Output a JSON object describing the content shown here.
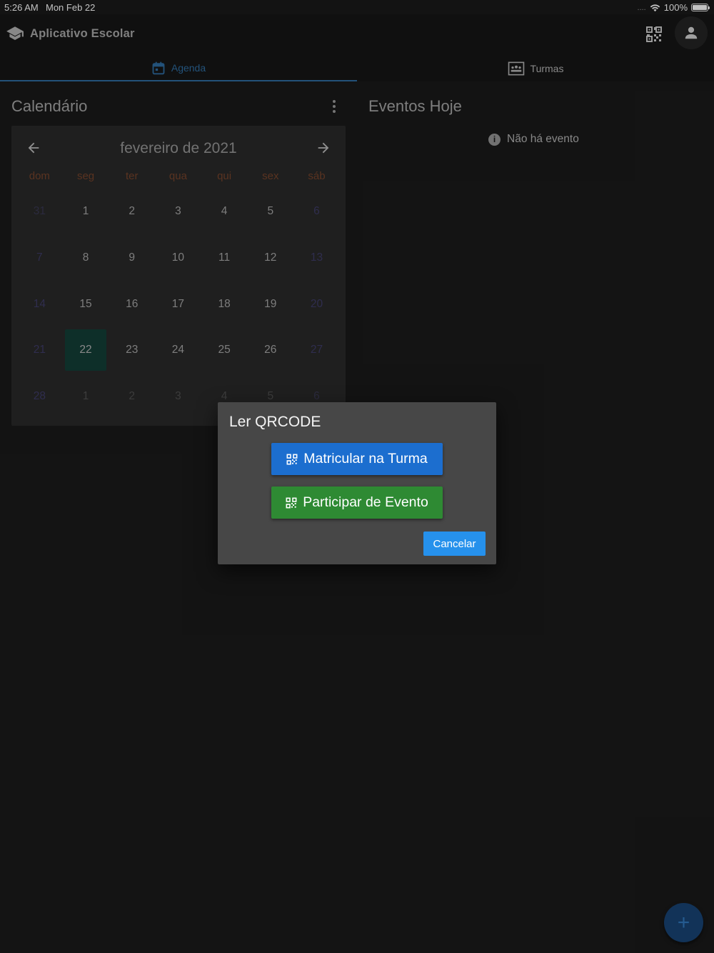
{
  "status_bar": {
    "time": "5:26 AM",
    "date": "Mon Feb 22",
    "signal": "....",
    "battery": "100%"
  },
  "header": {
    "title": "Aplicativo Escolar"
  },
  "tabs": [
    {
      "label": "Agenda",
      "active": true
    },
    {
      "label": "Turmas",
      "active": false
    }
  ],
  "calendar": {
    "title": "Calendário",
    "month_label": "fevereiro de 2021",
    "weekdays": [
      "dom",
      "seg",
      "ter",
      "qua",
      "qui",
      "sex",
      "sáb"
    ],
    "weeks": [
      [
        "31",
        "1",
        "2",
        "3",
        "4",
        "5",
        "6"
      ],
      [
        "7",
        "8",
        "9",
        "10",
        "11",
        "12",
        "13"
      ],
      [
        "14",
        "15",
        "16",
        "17",
        "18",
        "19",
        "20"
      ],
      [
        "21",
        "22",
        "23",
        "24",
        "25",
        "26",
        "27"
      ],
      [
        "28",
        "1",
        "2",
        "3",
        "4",
        "5",
        "6"
      ]
    ],
    "today": "22"
  },
  "events": {
    "title": "Eventos Hoje",
    "empty_message": "Não há evento"
  },
  "dialog": {
    "title": "Ler QRCODE",
    "enroll_label": "Matricular na Turma",
    "event_label": "Participar de Evento",
    "cancel_label": "Cancelar"
  },
  "fab": {
    "label": "+"
  },
  "colors": {
    "accent": "#2b6595",
    "enroll_button": "#1c6ecf",
    "event_button": "#2e8a33",
    "cancel_button": "#2691ec",
    "today_highlight": "#123a33"
  }
}
